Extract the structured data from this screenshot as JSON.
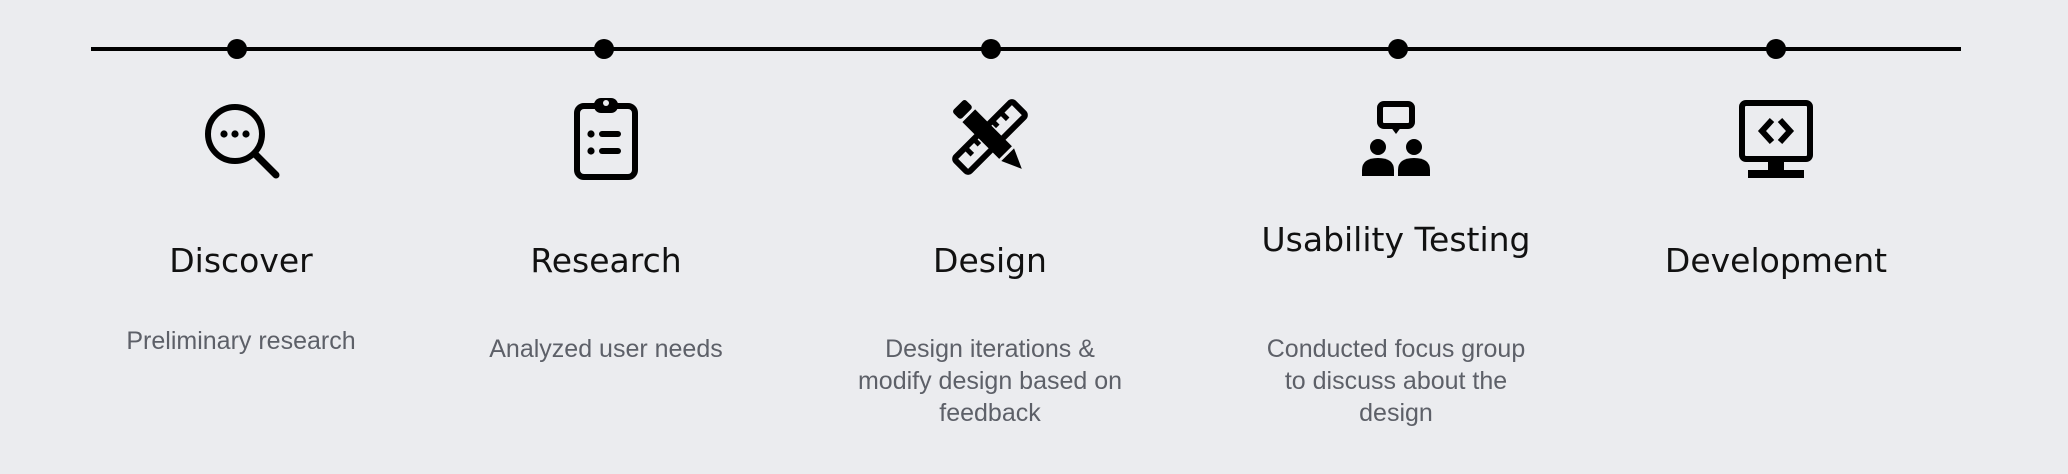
{
  "stages": [
    {
      "title": "Discover",
      "description": "Preliminary research",
      "icon": "magnifier-dots-icon"
    },
    {
      "title": "Research",
      "description": "Analyzed user needs",
      "icon": "clipboard-list-icon"
    },
    {
      "title": "Design",
      "description": "Design iterations & modify design based on feedback",
      "icon": "pencil-ruler-icon"
    },
    {
      "title": "Usability Testing",
      "description": "Conducted focus group to discuss about the design",
      "icon": "focus-group-icon"
    },
    {
      "title": "Development",
      "description": "",
      "icon": "code-monitor-icon"
    }
  ],
  "colors": {
    "background": "#ebecef",
    "line": "#000000",
    "title": "#111111",
    "description": "#5d6068"
  }
}
